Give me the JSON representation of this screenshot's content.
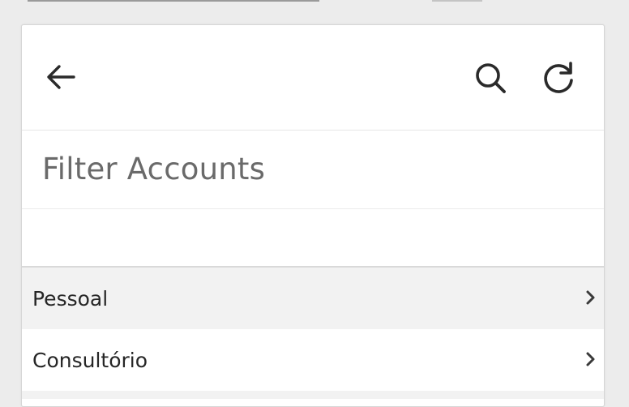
{
  "header": {
    "back_icon": "arrow-left-icon",
    "search_icon": "search-icon",
    "refresh_icon": "refresh-icon"
  },
  "page": {
    "title": "Filter Accounts"
  },
  "accounts": [
    {
      "label": "Pessoal",
      "icon": "chevron-right-icon"
    },
    {
      "label": "Consultório",
      "icon": "chevron-right-icon"
    }
  ],
  "colors": {
    "background": "#ececec",
    "card": "#ffffff",
    "row_alt": "#f2f2f2",
    "icon": "#2a2a2a",
    "title_text": "#6a6a6a"
  }
}
